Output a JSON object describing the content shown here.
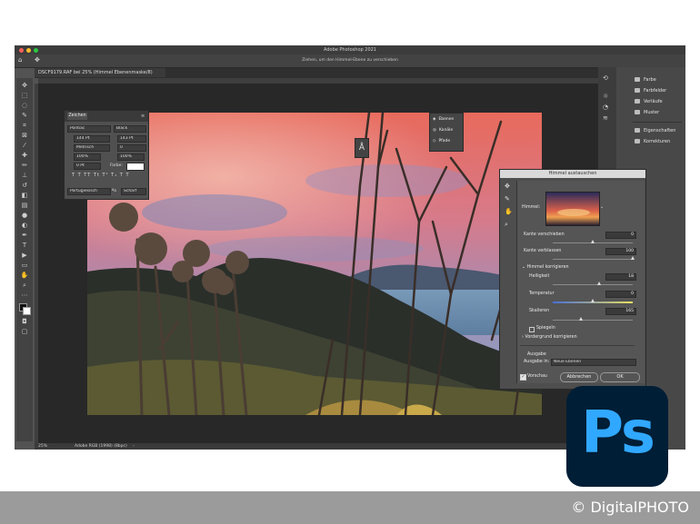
{
  "app": {
    "window_title": "Adobe Photoshop 2021",
    "options_hint": "Ziehen, um den Himmel-Ebene zu verschieben",
    "document_tab": "DSCF9179.RAF bei 25% (Himmel Ebenenmaske/8)",
    "status": {
      "zoom": "25%",
      "profile": "Adobe RGB (1998) (8bpc)"
    }
  },
  "right_panel": {
    "items": [
      {
        "label": "Farbe",
        "icon": "color-icon"
      },
      {
        "label": "Farbfelder",
        "icon": "swatches-icon"
      },
      {
        "label": "Verläufe",
        "icon": "gradient-icon"
      },
      {
        "label": "Muster",
        "icon": "pattern-icon"
      },
      {
        "label": "Eigenschaften",
        "icon": "properties-icon"
      },
      {
        "label": "Korrekturen",
        "icon": "adjustments-icon"
      }
    ]
  },
  "zeichen_panel": {
    "title": "Zeichen",
    "font_family": "Pontiac",
    "font_style": "Black",
    "font_size": "144 Pt",
    "leading": "143 Pt",
    "kerning": "Metrisch",
    "tracking": "0",
    "vertical_scale": "100%",
    "horizontal_scale": "100%",
    "baseline": "0 Pt",
    "color_label": "Farbe:",
    "type_buttons": "T T TT Tt T¹ T₁ T T",
    "language": "Portugiesisch",
    "aa_label": "ªa",
    "aa_value": "Scharf"
  },
  "ebenen_panel": {
    "items": [
      {
        "label": "Ebenen",
        "icon": "layers-icon"
      },
      {
        "label": "Kanäle",
        "icon": "channels-icon"
      },
      {
        "label": "Pfade",
        "icon": "paths-icon"
      }
    ]
  },
  "sky_dialog": {
    "title": "Himmel austauschen",
    "sky_label": "Himmel:",
    "edge_shift_label": "Kante verschieben",
    "edge_shift_value": "0",
    "edge_fade_label": "Kante verblassen",
    "edge_fade_value": "100",
    "sky_adjust_label": "Himmel korrigieren",
    "brightness_label": "Helligkeit",
    "brightness_value": "18",
    "temperature_label": "Temperatur",
    "temperature_value": "0",
    "scale_label": "Skalieren",
    "scale_value": "165",
    "flip_label": "Spiegeln",
    "foreground_label": "Vordergrund korrigieren",
    "output_label": "Ausgabe",
    "output_to_label": "Ausgabe in:",
    "output_to_value": "Neue Ebenen",
    "preview_label": "Vorschau",
    "cancel_label": "Abbrechen",
    "ok_label": "OK",
    "sliders": {
      "edge_shift": 0.5,
      "edge_fade": 1.0,
      "brightness": 0.59,
      "temperature": 0.5,
      "scale": 0.36
    }
  },
  "logo": {
    "text": "Ps"
  },
  "credit": "© DigitalPHOTO",
  "colors": {
    "ps_blue": "#31a8ff",
    "ps_navy": "#001e36",
    "band_gray": "#9b9b9b"
  }
}
